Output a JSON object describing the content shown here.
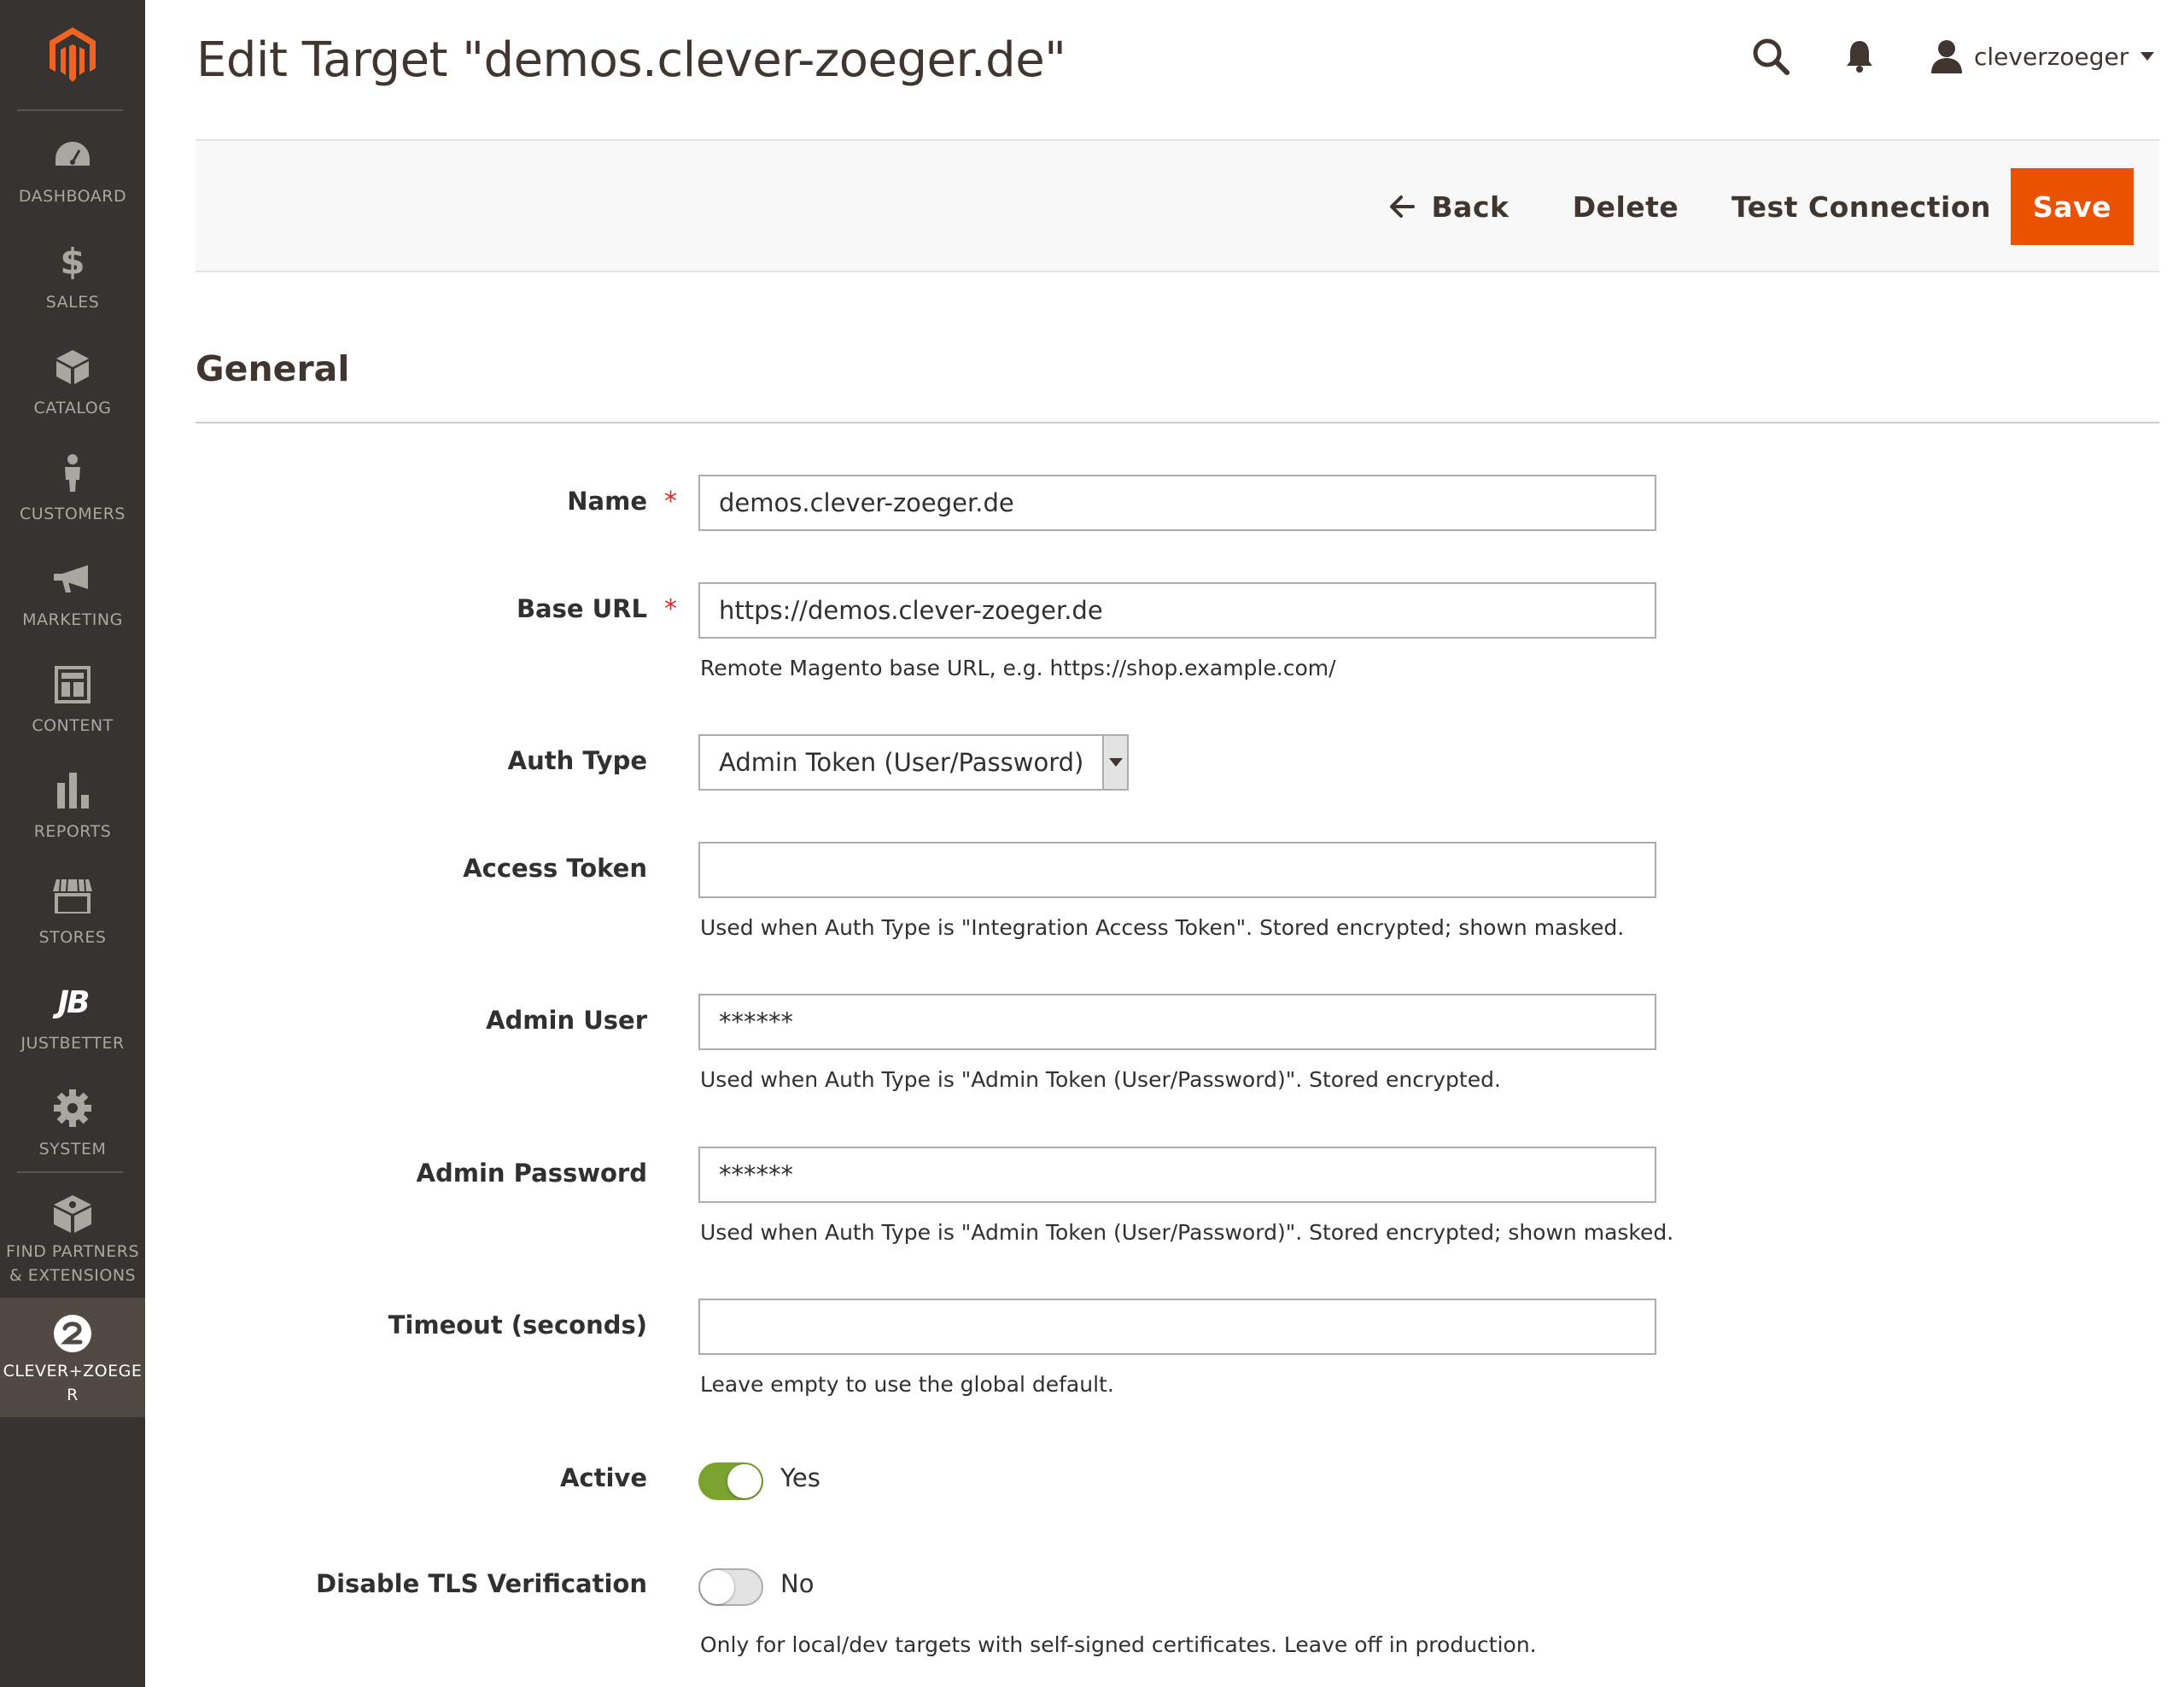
{
  "sidebar": {
    "items": [
      {
        "label": "DASHBOARD",
        "icon": "dashboard-icon"
      },
      {
        "label": "SALES",
        "icon": "dollar-icon"
      },
      {
        "label": "CATALOG",
        "icon": "box-icon"
      },
      {
        "label": "CUSTOMERS",
        "icon": "person-icon"
      },
      {
        "label": "MARKETING",
        "icon": "megaphone-icon"
      },
      {
        "label": "CONTENT",
        "icon": "layout-icon"
      },
      {
        "label": "REPORTS",
        "icon": "bar-chart-icon"
      },
      {
        "label": "STORES",
        "icon": "storefront-icon"
      },
      {
        "label": "JUSTBETTER",
        "icon": "jb-icon"
      },
      {
        "label": "SYSTEM",
        "icon": "gear-icon"
      },
      {
        "label_line1": "FIND PARTNERS",
        "label_line2": "& EXTENSIONS",
        "icon": "cube-icon"
      },
      {
        "label_line1": "CLEVER+ZOEGE",
        "label_line2": "R",
        "icon": "clever-zoeger-icon",
        "active": true
      }
    ]
  },
  "header": {
    "title": "Edit Target \"demos.clever-zoeger.de\"",
    "user": "cleverzoeger"
  },
  "toolbar": {
    "back_label": "Back",
    "delete_label": "Delete",
    "test_label": "Test Connection",
    "save_label": "Save"
  },
  "section": {
    "title": "General"
  },
  "form": {
    "name": {
      "label": "Name",
      "value": "demos.clever-zoeger.de"
    },
    "base_url": {
      "label": "Base URL",
      "value": "https://demos.clever-zoeger.de",
      "note": "Remote Magento base URL, e.g. https://shop.example.com/"
    },
    "auth_type": {
      "label": "Auth Type",
      "value": "Admin Token (User/Password)"
    },
    "access_token": {
      "label": "Access Token",
      "value": "",
      "note": "Used when Auth Type is \"Integration Access Token\". Stored encrypted; shown masked."
    },
    "admin_user": {
      "label": "Admin User",
      "value": "******",
      "note": "Used when Auth Type is \"Admin Token (User/Password)\". Stored encrypted."
    },
    "admin_password": {
      "label": "Admin Password",
      "value": "******",
      "note": "Used when Auth Type is \"Admin Token (User/Password)\". Stored encrypted; shown masked."
    },
    "timeout": {
      "label": "Timeout (seconds)",
      "value": "",
      "note": "Leave empty to use the global default."
    },
    "active": {
      "label": "Active",
      "state": "Yes"
    },
    "disable_tls": {
      "label": "Disable TLS Verification",
      "state": "No",
      "note": "Only for local/dev targets with self-signed certificates. Leave off in production."
    }
  },
  "colors": {
    "accent": "#eb5202",
    "sidebar": "#373330",
    "toggle_on": "#79a22e"
  }
}
